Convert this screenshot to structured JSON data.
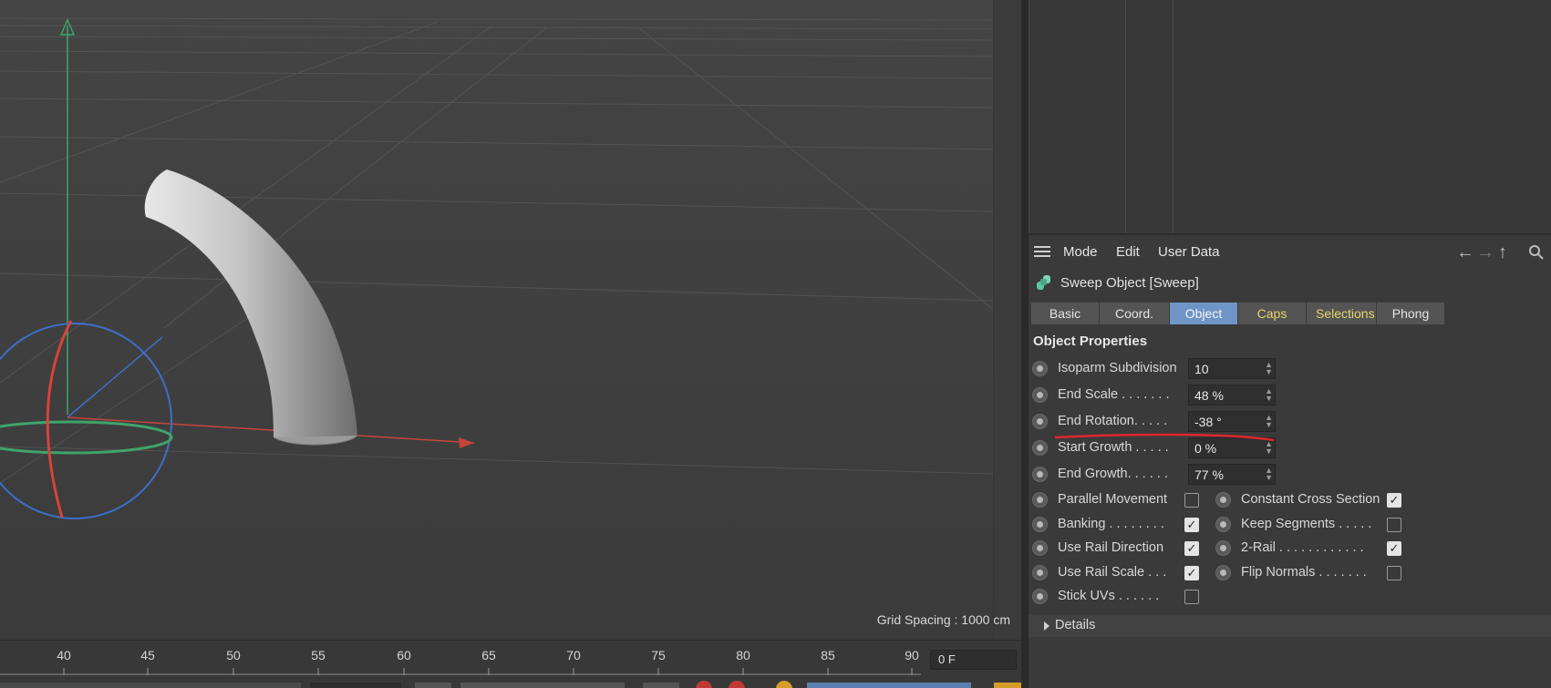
{
  "viewport": {
    "grid_spacing": "Grid Spacing : 1000 cm"
  },
  "attribute_manager": {
    "menu": {
      "mode": "Mode",
      "edit": "Edit",
      "user_data": "User Data"
    },
    "object_title": "Sweep Object [Sweep]",
    "tabs": [
      {
        "label": "Basic",
        "state": "normal"
      },
      {
        "label": "Coord.",
        "state": "normal"
      },
      {
        "label": "Object",
        "state": "active"
      },
      {
        "label": "Caps",
        "state": "yellow"
      },
      {
        "label": "Selections",
        "state": "yellow"
      },
      {
        "label": "Phong",
        "state": "normal"
      }
    ],
    "section_title": "Object Properties",
    "fields": [
      {
        "label": "Isoparm Subdivision",
        "value": "10"
      },
      {
        "label": "End Scale . . . . . . .",
        "value": "48 %"
      },
      {
        "label": "End Rotation. . . . .",
        "value": "-38 °"
      },
      {
        "label": "Start Growth . . . . .",
        "value": "0 %"
      },
      {
        "label": "End Growth. . . . . .",
        "value": "77 %"
      }
    ],
    "checkboxes_left": [
      {
        "label": "Parallel Movement",
        "checked": false
      },
      {
        "label": "Banking . . . . . . . .",
        "checked": true
      },
      {
        "label": "Use Rail Direction",
        "checked": true
      },
      {
        "label": "Use Rail Scale . . .",
        "checked": true
      },
      {
        "label": "Stick UVs . . . . . .",
        "checked": false
      }
    ],
    "checkboxes_right": [
      {
        "label": "Constant Cross Section",
        "checked": true
      },
      {
        "label": "Keep Segments . . . . .",
        "checked": false
      },
      {
        "label": "2-Rail . . . . . . . . . . . .",
        "checked": true
      },
      {
        "label": "Flip Normals . . . . . . .",
        "checked": false
      }
    ],
    "details": "Details",
    "active_tab_color": "#6f95c7",
    "annotation_color": "#e0262b"
  },
  "timeline": {
    "ticks": [
      "40",
      "45",
      "50",
      "55",
      "60",
      "65",
      "70",
      "75",
      "80",
      "85",
      "90"
    ],
    "current_frame": "0 F"
  }
}
